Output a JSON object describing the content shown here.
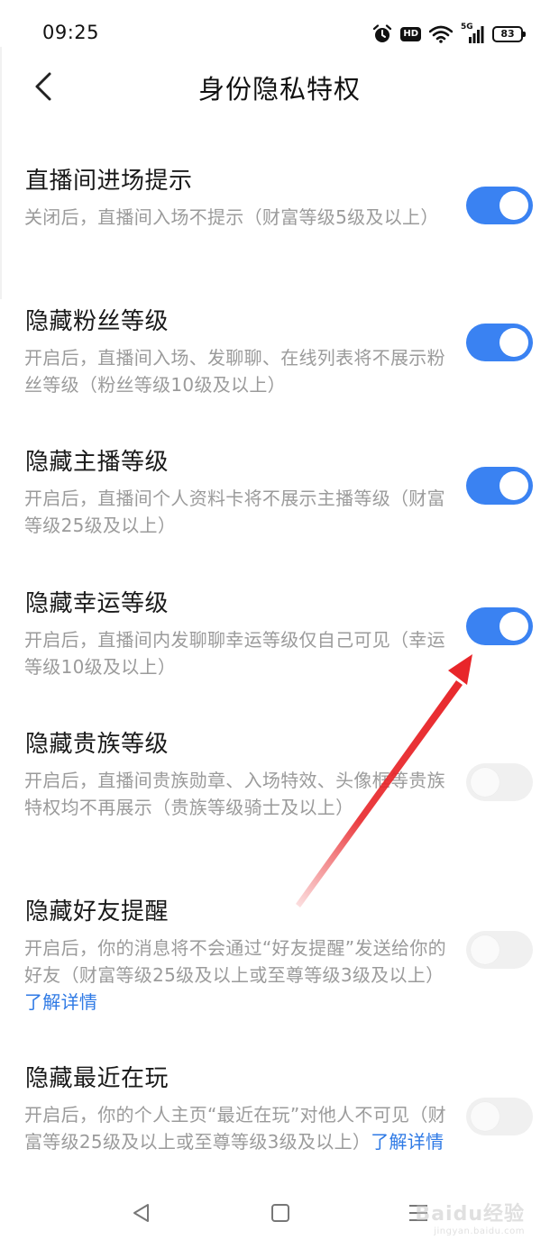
{
  "status_bar": {
    "time": "09:25",
    "hd": "HD",
    "network": "5G",
    "battery": "83"
  },
  "header": {
    "title": "身份隐私特权"
  },
  "settings": [
    {
      "title": "直播间进场提示",
      "desc": "关闭后，直播间入场不提示（财富等级5级及以上）",
      "link": "",
      "enabled": true
    },
    {
      "title": "隐藏粉丝等级",
      "desc": "开启后，直播间入场、发聊聊、在线列表将不展示粉丝等级（粉丝等级10级及以上）",
      "link": "",
      "enabled": true
    },
    {
      "title": "隐藏主播等级",
      "desc": "开启后，直播间个人资料卡将不展示主播等级（财富等级25级及以上）",
      "link": "",
      "enabled": true
    },
    {
      "title": "隐藏幸运等级",
      "desc": "开启后，直播间内发聊聊幸运等级仅自己可见（幸运等级10级及以上）",
      "link": "",
      "enabled": true
    },
    {
      "title": "隐藏贵族等级",
      "desc": "开启后，直播间贵族勋章、入场特效、头像框等贵族特权均不再展示（贵族等级骑士及以上）",
      "link": "",
      "enabled": false
    },
    {
      "title": "隐藏好友提醒",
      "desc": "开启后，你的消息将不会通过“好友提醒”发送给你的好友（财富等级25级及以上或至尊等级3级及以上）",
      "link": "了解详情",
      "enabled": false
    },
    {
      "title": "隐藏最近在玩",
      "desc": "开启后，你的个人主页“最近在玩”对他人不可见（财富等级25级及以上或至尊等级3级及以上）",
      "link": "了解详情",
      "enabled": false
    }
  ],
  "watermark": {
    "main": "Baidu经验",
    "sub": "jingyan.baidu.com"
  },
  "colors": {
    "toggle_on": "#3a82f2",
    "toggle_off": "#f0f0f0",
    "link": "#2f7ae5",
    "arrow": "#e8262a"
  }
}
